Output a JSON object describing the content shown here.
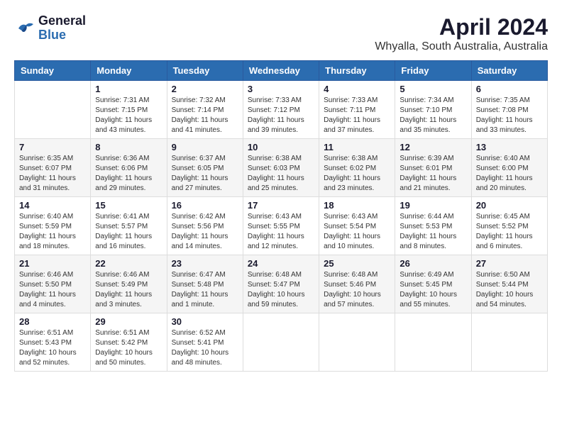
{
  "header": {
    "logo": {
      "line1": "General",
      "line2": "Blue"
    },
    "title": "April 2024",
    "location": "Whyalla, South Australia, Australia"
  },
  "weekdays": [
    "Sunday",
    "Monday",
    "Tuesday",
    "Wednesday",
    "Thursday",
    "Friday",
    "Saturday"
  ],
  "weeks": [
    [
      {
        "day": "",
        "info": ""
      },
      {
        "day": "1",
        "info": "Sunrise: 7:31 AM\nSunset: 7:15 PM\nDaylight: 11 hours\nand 43 minutes."
      },
      {
        "day": "2",
        "info": "Sunrise: 7:32 AM\nSunset: 7:14 PM\nDaylight: 11 hours\nand 41 minutes."
      },
      {
        "day": "3",
        "info": "Sunrise: 7:33 AM\nSunset: 7:12 PM\nDaylight: 11 hours\nand 39 minutes."
      },
      {
        "day": "4",
        "info": "Sunrise: 7:33 AM\nSunset: 7:11 PM\nDaylight: 11 hours\nand 37 minutes."
      },
      {
        "day": "5",
        "info": "Sunrise: 7:34 AM\nSunset: 7:10 PM\nDaylight: 11 hours\nand 35 minutes."
      },
      {
        "day": "6",
        "info": "Sunrise: 7:35 AM\nSunset: 7:08 PM\nDaylight: 11 hours\nand 33 minutes."
      }
    ],
    [
      {
        "day": "7",
        "info": "Sunrise: 6:35 AM\nSunset: 6:07 PM\nDaylight: 11 hours\nand 31 minutes."
      },
      {
        "day": "8",
        "info": "Sunrise: 6:36 AM\nSunset: 6:06 PM\nDaylight: 11 hours\nand 29 minutes."
      },
      {
        "day": "9",
        "info": "Sunrise: 6:37 AM\nSunset: 6:05 PM\nDaylight: 11 hours\nand 27 minutes."
      },
      {
        "day": "10",
        "info": "Sunrise: 6:38 AM\nSunset: 6:03 PM\nDaylight: 11 hours\nand 25 minutes."
      },
      {
        "day": "11",
        "info": "Sunrise: 6:38 AM\nSunset: 6:02 PM\nDaylight: 11 hours\nand 23 minutes."
      },
      {
        "day": "12",
        "info": "Sunrise: 6:39 AM\nSunset: 6:01 PM\nDaylight: 11 hours\nand 21 minutes."
      },
      {
        "day": "13",
        "info": "Sunrise: 6:40 AM\nSunset: 6:00 PM\nDaylight: 11 hours\nand 20 minutes."
      }
    ],
    [
      {
        "day": "14",
        "info": "Sunrise: 6:40 AM\nSunset: 5:59 PM\nDaylight: 11 hours\nand 18 minutes."
      },
      {
        "day": "15",
        "info": "Sunrise: 6:41 AM\nSunset: 5:57 PM\nDaylight: 11 hours\nand 16 minutes."
      },
      {
        "day": "16",
        "info": "Sunrise: 6:42 AM\nSunset: 5:56 PM\nDaylight: 11 hours\nand 14 minutes."
      },
      {
        "day": "17",
        "info": "Sunrise: 6:43 AM\nSunset: 5:55 PM\nDaylight: 11 hours\nand 12 minutes."
      },
      {
        "day": "18",
        "info": "Sunrise: 6:43 AM\nSunset: 5:54 PM\nDaylight: 11 hours\nand 10 minutes."
      },
      {
        "day": "19",
        "info": "Sunrise: 6:44 AM\nSunset: 5:53 PM\nDaylight: 11 hours\nand 8 minutes."
      },
      {
        "day": "20",
        "info": "Sunrise: 6:45 AM\nSunset: 5:52 PM\nDaylight: 11 hours\nand 6 minutes."
      }
    ],
    [
      {
        "day": "21",
        "info": "Sunrise: 6:46 AM\nSunset: 5:50 PM\nDaylight: 11 hours\nand 4 minutes."
      },
      {
        "day": "22",
        "info": "Sunrise: 6:46 AM\nSunset: 5:49 PM\nDaylight: 11 hours\nand 3 minutes."
      },
      {
        "day": "23",
        "info": "Sunrise: 6:47 AM\nSunset: 5:48 PM\nDaylight: 11 hours\nand 1 minute."
      },
      {
        "day": "24",
        "info": "Sunrise: 6:48 AM\nSunset: 5:47 PM\nDaylight: 10 hours\nand 59 minutes."
      },
      {
        "day": "25",
        "info": "Sunrise: 6:48 AM\nSunset: 5:46 PM\nDaylight: 10 hours\nand 57 minutes."
      },
      {
        "day": "26",
        "info": "Sunrise: 6:49 AM\nSunset: 5:45 PM\nDaylight: 10 hours\nand 55 minutes."
      },
      {
        "day": "27",
        "info": "Sunrise: 6:50 AM\nSunset: 5:44 PM\nDaylight: 10 hours\nand 54 minutes."
      }
    ],
    [
      {
        "day": "28",
        "info": "Sunrise: 6:51 AM\nSunset: 5:43 PM\nDaylight: 10 hours\nand 52 minutes."
      },
      {
        "day": "29",
        "info": "Sunrise: 6:51 AM\nSunset: 5:42 PM\nDaylight: 10 hours\nand 50 minutes."
      },
      {
        "day": "30",
        "info": "Sunrise: 6:52 AM\nSunset: 5:41 PM\nDaylight: 10 hours\nand 48 minutes."
      },
      {
        "day": "",
        "info": ""
      },
      {
        "day": "",
        "info": ""
      },
      {
        "day": "",
        "info": ""
      },
      {
        "day": "",
        "info": ""
      }
    ]
  ]
}
